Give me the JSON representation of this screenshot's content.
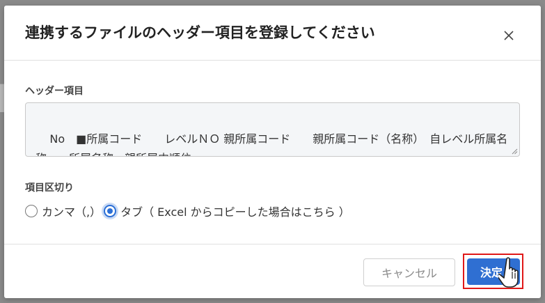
{
  "dialog": {
    "title": "連携するファイルのヘッダー項目を登録してください",
    "close_icon": "close-icon",
    "header_items": {
      "label": "ヘッダー項目",
      "value": "No　■所属コード　　レベルＮＯ 親所属コード　　親所属コード（名称）　自レベル所属名称　　所属名称　親所属内順位"
    },
    "delimiter": {
      "label": "項目区切り",
      "options": [
        {
          "label": "カンマ（,）",
          "selected": false
        },
        {
          "label": "タブ（ Excel からコピーした場合はこちら ）",
          "selected": true
        }
      ]
    },
    "footer": {
      "cancel_label": "キャンセル",
      "ok_label": "決定"
    }
  },
  "colors": {
    "accent": "#2f6fd2",
    "highlight": "#e01818"
  },
  "icons": {
    "cursor": "hand-pointer-icon"
  }
}
